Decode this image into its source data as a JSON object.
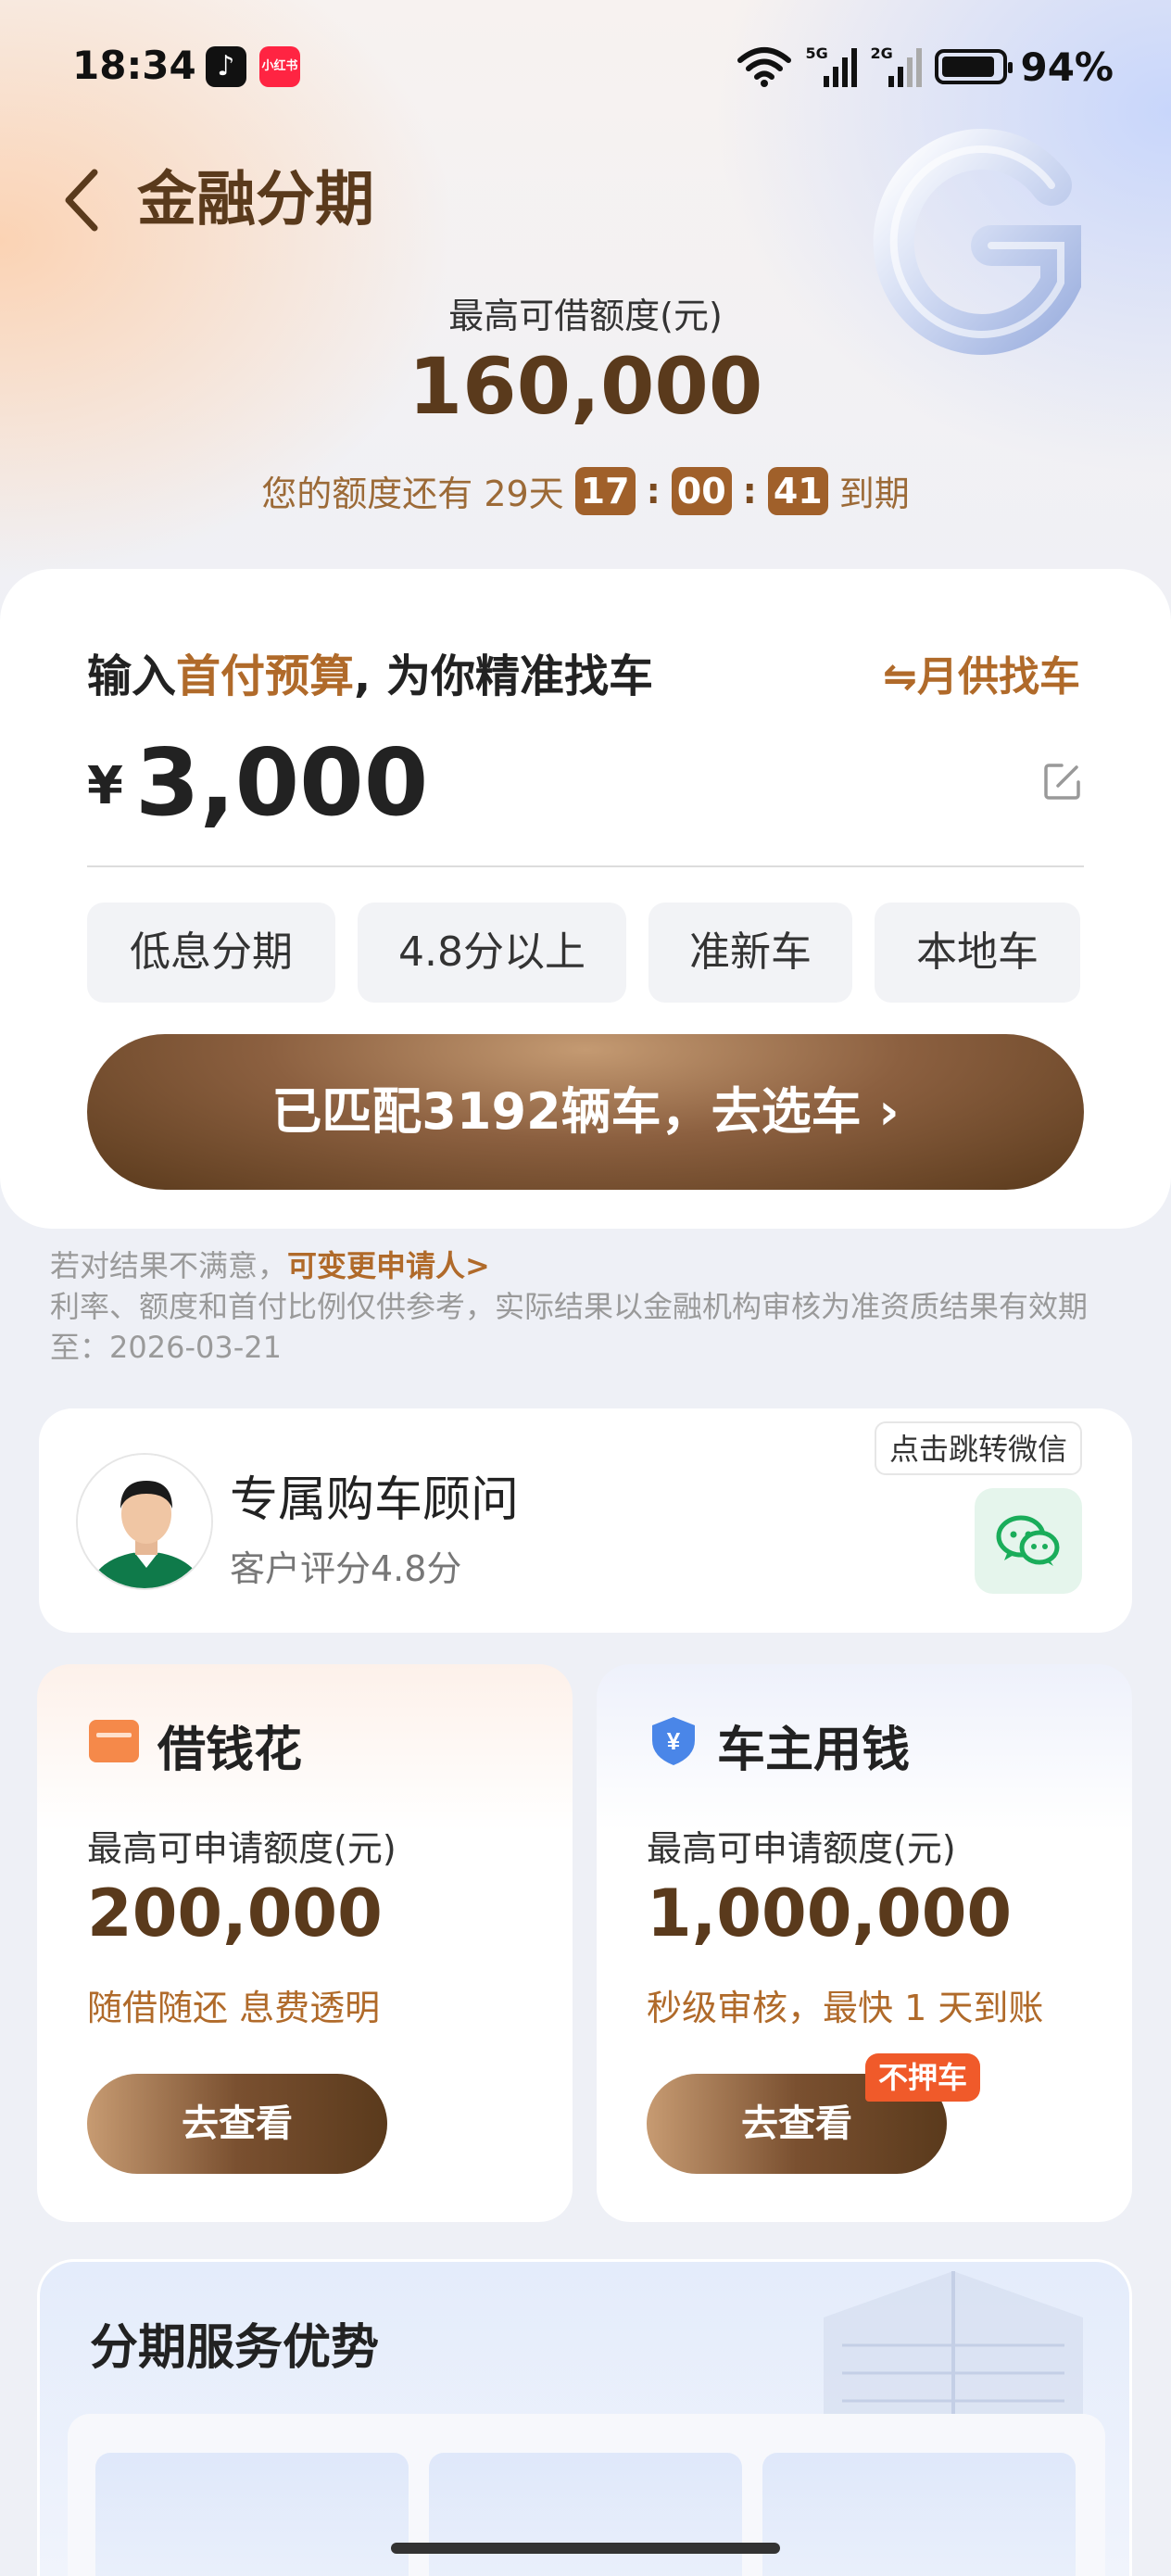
{
  "status_bar": {
    "time": "18:34",
    "apps": [
      "tiktok-icon",
      "xiaohongshu-icon"
    ],
    "xhs_label": "小红书",
    "net1": "5G",
    "net2": "2G",
    "battery": "94%"
  },
  "header": {
    "title": "金融分期",
    "limit_label": "最高可借额度(元)",
    "limit_value": "160,000",
    "countdown_prefix": "您的额度还有 29天",
    "hours": "17",
    "minutes": "00",
    "seconds": "41",
    "countdown_suffix": "到期"
  },
  "budget_card": {
    "title_pre": "输入",
    "title_highlight": "首付预算",
    "title_post": ", 为你精准找车",
    "switch_label": "⇋月供找车",
    "currency": "¥",
    "amount": "3,000",
    "chips": [
      "低息分期",
      "4.8分以上",
      "准新车",
      "本地车"
    ],
    "cta": "已匹配3192辆车，去选车 ›"
  },
  "notes": {
    "line1_pre": "若对结果不满意，",
    "line1_link": "可变更申请人>",
    "line2": "利率、额度和首付比例仅供参考，实际结果以金融机构审核为准资质结果有效期至：2026-03-21"
  },
  "advisor": {
    "name": "专属购车顾问",
    "score": "客户评分4.8分",
    "wechat_tip": "点击跳转微信"
  },
  "products": [
    {
      "title": "借钱花",
      "label": "最高可申请额度(元)",
      "value": "200,000",
      "desc": "随借随还 息费透明",
      "button": "去查看"
    },
    {
      "title": "车主用钱",
      "label": "最高可申请额度(元)",
      "value": "1,000,000",
      "desc": "秒级审核，最快 1 天到账",
      "button": "去查看",
      "badge": "不押车"
    }
  ],
  "advantages": {
    "title": "分期服务优势"
  },
  "colors": {
    "brand_brown": "#5a3a1c",
    "accent_orange": "#b06a2a",
    "badge_red": "#f05a2a",
    "wechat_green": "#1aad5a"
  }
}
